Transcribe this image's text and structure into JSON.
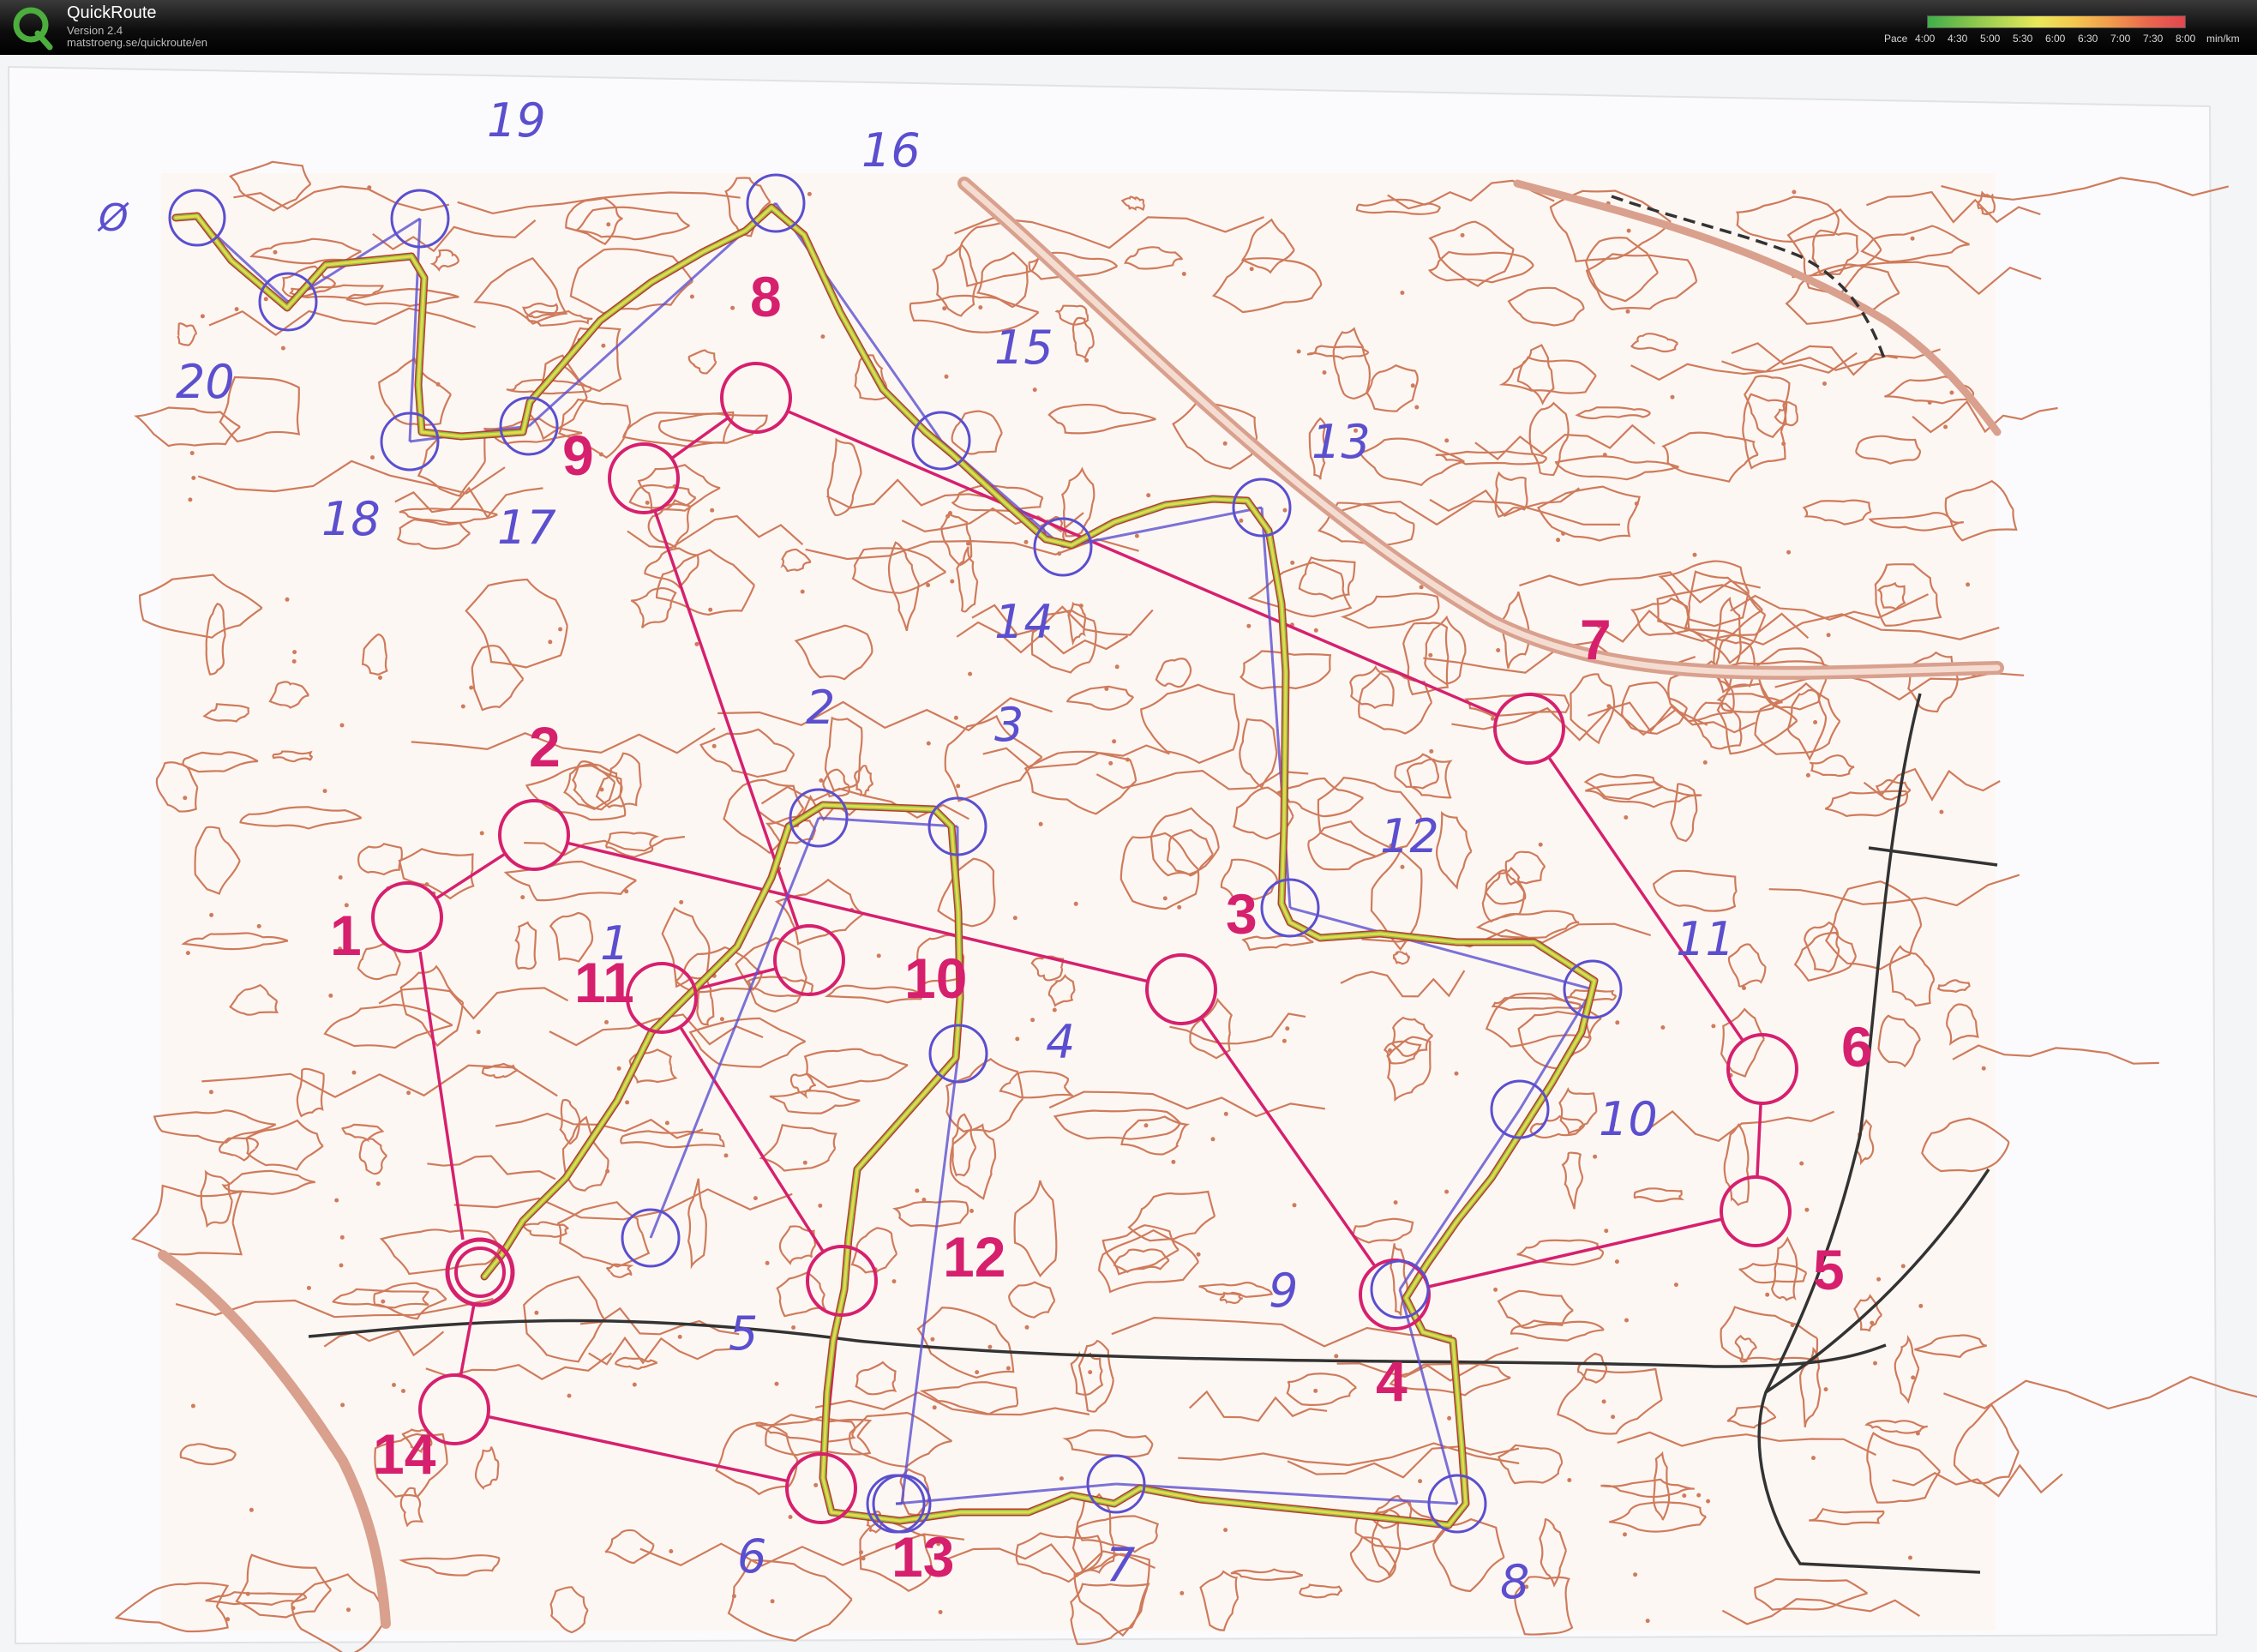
{
  "app": {
    "name": "QuickRoute",
    "version": "Version 2.4",
    "url": "matstroeng.se/quickroute/en"
  },
  "pace_legend": {
    "label": "Pace",
    "ticks": [
      "4:00",
      "4:30",
      "5:00",
      "5:30",
      "6:00",
      "6:30",
      "7:00",
      "7:30",
      "8:00"
    ],
    "unit": "min/km",
    "colors": [
      "#3fae49",
      "#7cc24b",
      "#b4d653",
      "#e9e85a",
      "#f5c64f",
      "#f19a4b",
      "#e9674c",
      "#e3464f"
    ]
  },
  "map": {
    "colors": {
      "paper": "#fbfbfd",
      "contour": "#cf7b5c",
      "course_pink": "#d6206e",
      "pen_blue": "#5b4fcf",
      "road": "#d9a08e",
      "path": "#333333",
      "gps_outer": "#c0392b",
      "gps_inner": "#e8d84a",
      "gps_mid": "#8bc34a"
    },
    "pink_labels": [
      "1",
      "2",
      "3",
      "4",
      "5",
      "6",
      "7",
      "8",
      "9",
      "10",
      "11",
      "12",
      "13",
      "14"
    ],
    "blue_labels": [
      "1",
      "2",
      "3",
      "4",
      "5",
      "6",
      "7",
      "8",
      "9",
      "10",
      "11",
      "12",
      "13",
      "14",
      "15",
      "16",
      "17",
      "18",
      "19",
      "20"
    ]
  }
}
